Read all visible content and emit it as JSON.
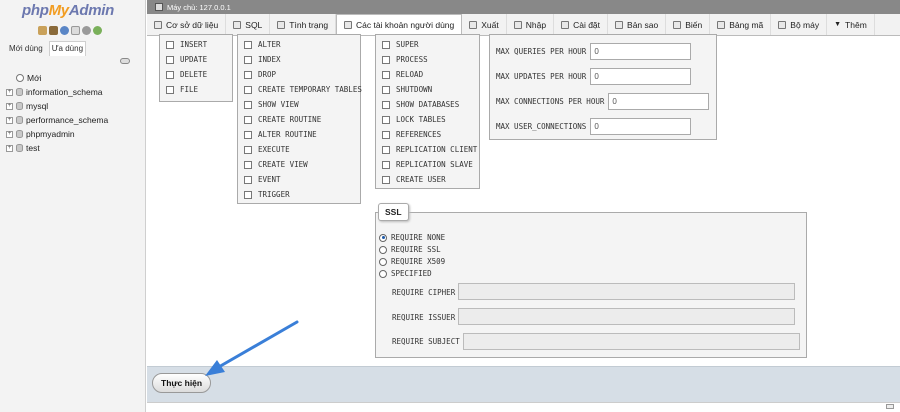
{
  "logo": {
    "part1": "php",
    "part2": "My",
    "part3": "Admin"
  },
  "sidebar": {
    "recent_tabs": [
      "Mới dùng",
      "Ưa dùng"
    ],
    "tree": [
      {
        "label": "Mới",
        "type": "new"
      },
      {
        "label": "information_schema",
        "type": "db"
      },
      {
        "label": "mysql",
        "type": "db"
      },
      {
        "label": "performance_schema",
        "type": "db"
      },
      {
        "label": "phpmyadmin",
        "type": "db"
      },
      {
        "label": "test",
        "type": "db"
      }
    ]
  },
  "topbar": {
    "server": "Máy chủ: 127.0.0.1"
  },
  "menu": [
    {
      "label": "Cơ sở dữ liệu",
      "icon": "database-icon"
    },
    {
      "label": "SQL",
      "icon": "sql-icon"
    },
    {
      "label": "Tình trạng",
      "icon": "status-icon"
    },
    {
      "label": "Các tài khoản người dùng",
      "icon": "users-icon",
      "active": true
    },
    {
      "label": "Xuất",
      "icon": "export-icon"
    },
    {
      "label": "Nhập",
      "icon": "import-icon"
    },
    {
      "label": "Cài đặt",
      "icon": "settings-icon"
    },
    {
      "label": "Bản sao",
      "icon": "replication-icon"
    },
    {
      "label": "Biến",
      "icon": "variables-icon"
    },
    {
      "label": "Bảng mã",
      "icon": "charsets-icon"
    },
    {
      "label": "Bộ máy",
      "icon": "engines-icon"
    },
    {
      "label": "Thêm",
      "icon": "more-icon"
    }
  ],
  "privileges": {
    "data": [
      "INSERT",
      "UPDATE",
      "DELETE",
      "FILE"
    ],
    "structure": [
      "ALTER",
      "INDEX",
      "DROP",
      "CREATE TEMPORARY TABLES",
      "SHOW VIEW",
      "CREATE ROUTINE",
      "ALTER ROUTINE",
      "EXECUTE",
      "CREATE VIEW",
      "EVENT",
      "TRIGGER"
    ],
    "administration": [
      "SUPER",
      "PROCESS",
      "RELOAD",
      "SHUTDOWN",
      "SHOW DATABASES",
      "LOCK TABLES",
      "REFERENCES",
      "REPLICATION CLIENT",
      "REPLICATION SLAVE",
      "CREATE USER"
    ]
  },
  "limits": [
    {
      "label": "MAX QUERIES PER HOUR",
      "value": "0"
    },
    {
      "label": "MAX UPDATES PER HOUR",
      "value": "0"
    },
    {
      "label": "MAX CONNECTIONS PER HOUR",
      "value": "0"
    },
    {
      "label": "MAX USER_CONNECTIONS",
      "value": "0"
    }
  ],
  "ssl": {
    "legend": "SSL",
    "options": [
      "REQUIRE NONE",
      "REQUIRE SSL",
      "REQUIRE X509",
      "SPECIFIED"
    ],
    "selected": "REQUIRE NONE",
    "fields": [
      "REQUIRE CIPHER",
      "REQUIRE ISSUER",
      "REQUIRE SUBJECT"
    ]
  },
  "footer": {
    "go_label": "Thực hiện"
  }
}
